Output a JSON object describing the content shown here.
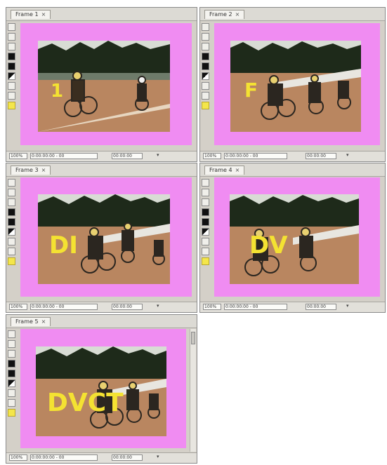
{
  "colors": {
    "canvas_background": "#f08cf2",
    "annotation": "#f4e232",
    "window_chrome": "#d4d0c8"
  },
  "panels": [
    {
      "tab_title": "Frame 1",
      "annotation": "1",
      "zoom": "100%",
      "timecode": "0:00:00:00 - 00",
      "frame": "00:00:00"
    },
    {
      "tab_title": "Frame 2",
      "annotation": "F",
      "zoom": "100%",
      "timecode": "0:00:00:00 - 00",
      "frame": "00:00:00"
    },
    {
      "tab_title": "Frame 3",
      "annotation": "DI",
      "zoom": "100%",
      "timecode": "0:00:00:00 - 00",
      "frame": "00:00:00"
    },
    {
      "tab_title": "Frame 4",
      "annotation": "DV",
      "zoom": "100%",
      "timecode": "0:00:00:00 - 00",
      "frame": "00:00:00"
    },
    {
      "tab_title": "Frame 5",
      "annotation": "DVCT",
      "zoom": "100%",
      "timecode": "0:00:00:00 - 00",
      "frame": "00:00:00"
    }
  ]
}
